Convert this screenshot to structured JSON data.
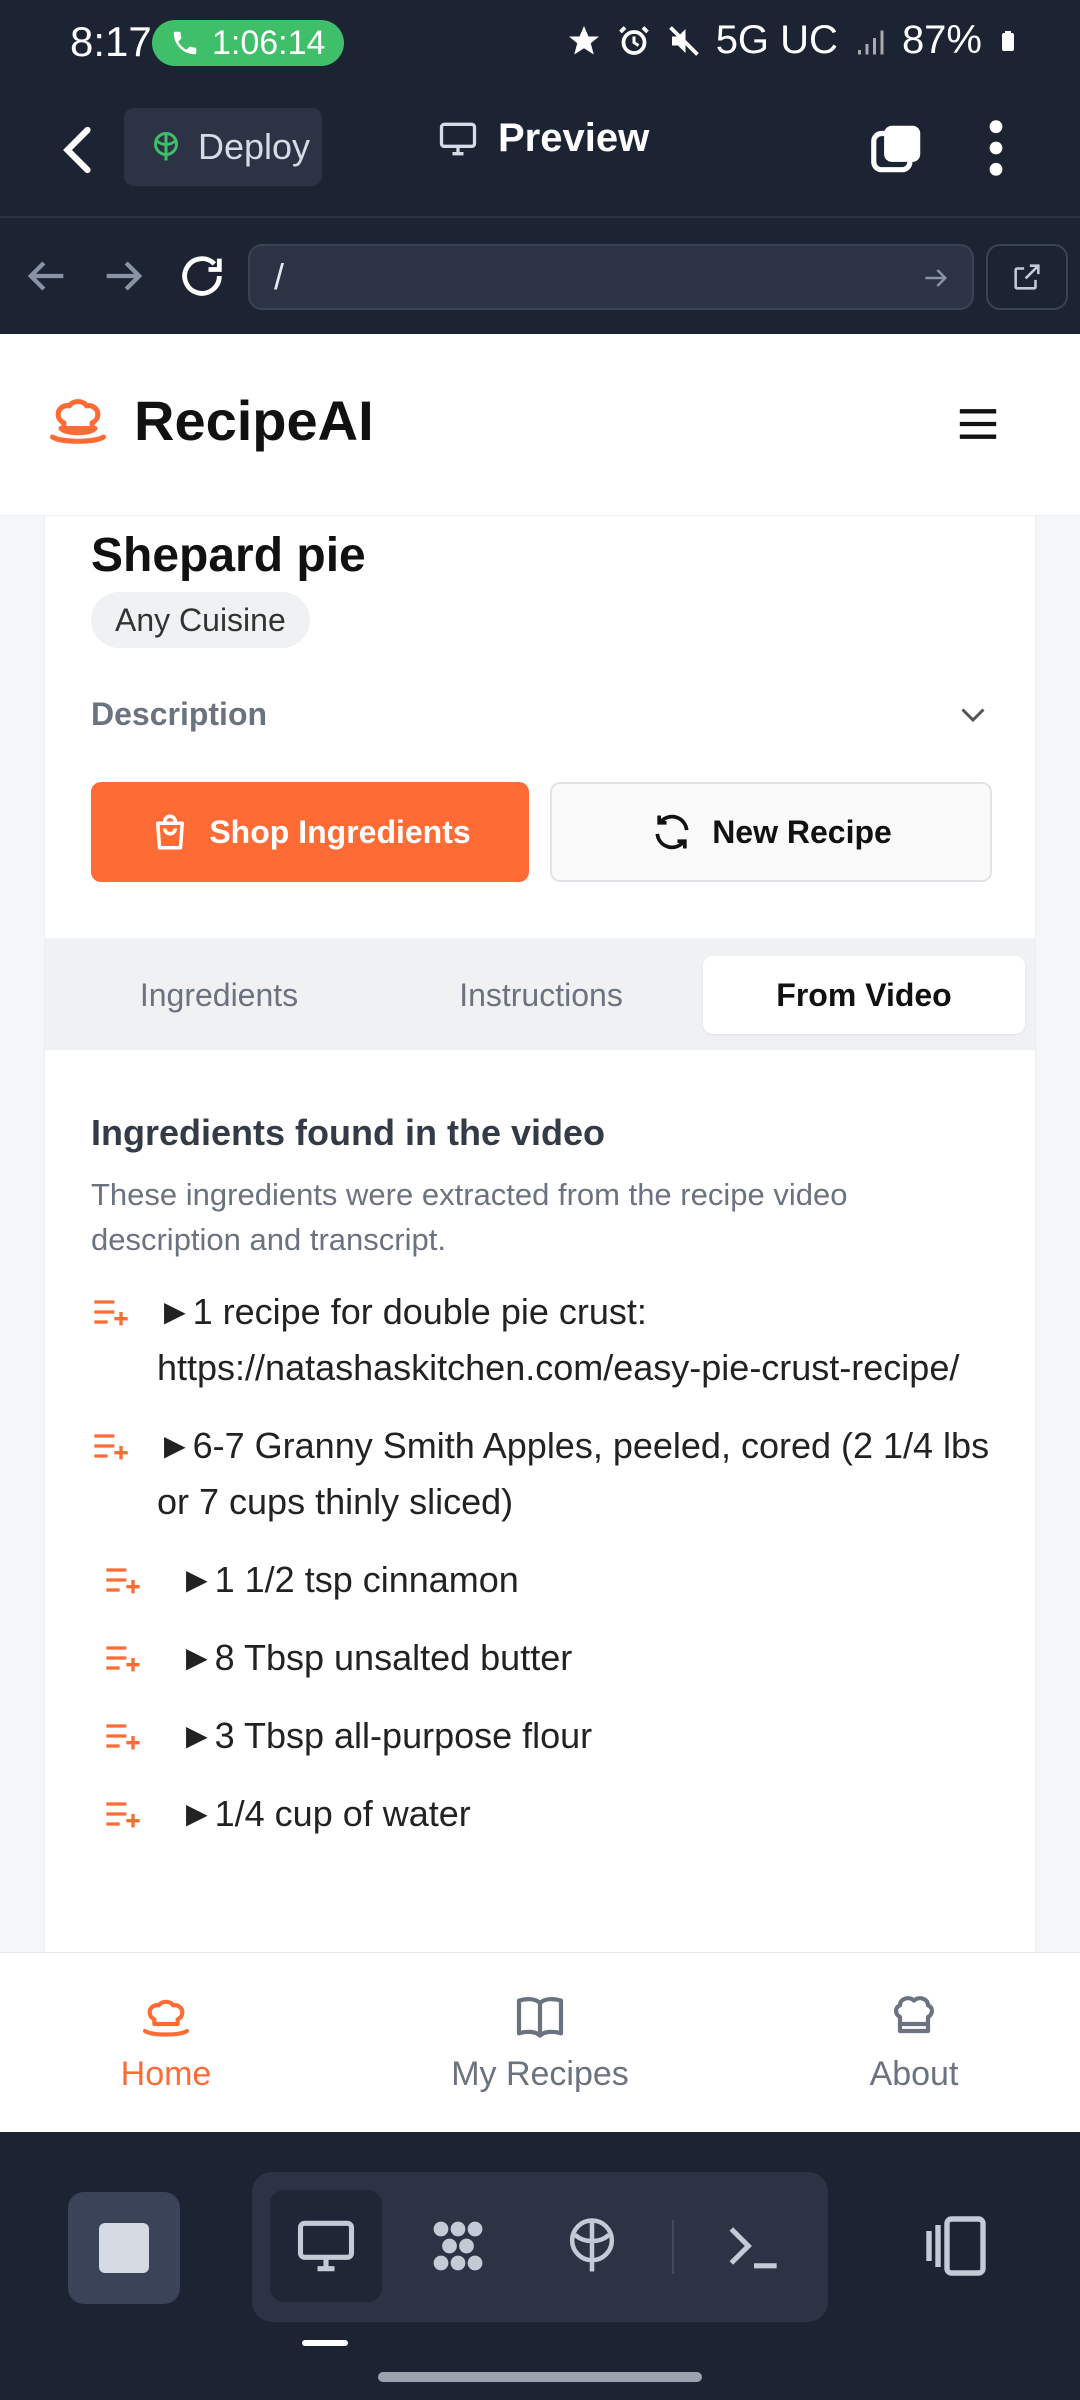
{
  "status_bar": {
    "time": "8:17",
    "call_timer": "1:06:14",
    "network": "5G UC",
    "battery": "87%",
    "icons": [
      "phone-icon",
      "star-icon",
      "alarm-icon",
      "mute-icon",
      "signal-icon",
      "battery-icon"
    ]
  },
  "app_bar": {
    "deploy_label": "Deploy",
    "title": "Preview"
  },
  "url_bar": {
    "value": "/"
  },
  "site": {
    "brand": "RecipeAI",
    "accent": "#ff6b35"
  },
  "recipe": {
    "title": "Shepard pie",
    "cuisine": "Any Cuisine",
    "description_label": "Description",
    "shop_button": "Shop Ingredients",
    "new_button": "New Recipe"
  },
  "tabs": [
    {
      "label": "Ingredients",
      "active": false
    },
    {
      "label": "Instructions",
      "active": false
    },
    {
      "label": "From Video",
      "active": true
    }
  ],
  "video_section": {
    "title": "Ingredients found in the video",
    "subtitle": "These ingredients were extracted from the recipe video description and transcript.",
    "ingredients": [
      "►1 recipe for double pie crust: https://natashaskitchen.com/easy-pie-crust-recipe/",
      "►6-7 Granny Smith Apples, peeled, cored  (2 1/4 lbs or 7 cups thinly sliced)",
      "►1 1/2 tsp cinnamon",
      "►8 Tbsp unsalted butter",
      "►3 Tbsp all-purpose flour",
      "►1/4 cup of water"
    ]
  },
  "bottom_nav": [
    {
      "label": "Home",
      "active": true
    },
    {
      "label": "My Recipes",
      "active": false
    },
    {
      "label": "About",
      "active": false
    }
  ]
}
